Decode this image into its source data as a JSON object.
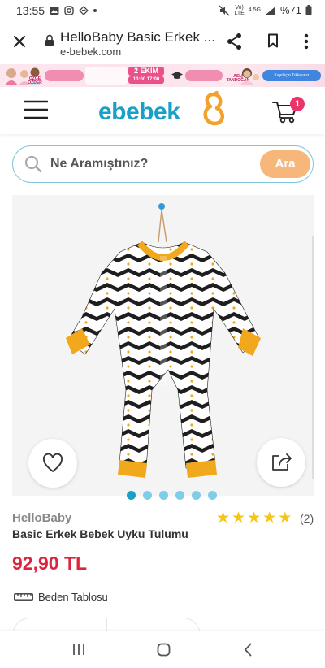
{
  "status_bar": {
    "time": "13:55",
    "net_top": "Vo)",
    "net_bottom": "LTE",
    "signal_label": "4.5G",
    "battery": "%71"
  },
  "browser": {
    "page_title": "HelloBaby Basic Erkek ...",
    "url": "e-bebek.com"
  },
  "promo": {
    "left_tag": "ÖZGE ÖZDER",
    "date_top": "2 EKİM",
    "date_time": "10:00 17:00",
    "right_tag": "ASLI TANDOĞAN",
    "cta": "Kayıt için Tıklayınız"
  },
  "header": {
    "logo": "ebebek",
    "cart_count": "1"
  },
  "search": {
    "placeholder": "Ne Aramıştınız?",
    "button_label": "Ara"
  },
  "product": {
    "brand": "HelloBaby",
    "name": "Basic Erkek Bebek Uyku Tulumu",
    "price": "92,90 TL",
    "rating_stars": 5,
    "review_count": "(2)",
    "size_table_label": "Beden Tablosu",
    "gallery_count": 6,
    "gallery_active": 0
  },
  "colors": {
    "brand_blue": "#1aa0c7",
    "price_red": "#e0233d",
    "search_button": "#f7b77a",
    "star": "#f5c518",
    "romper_trim": "#f2a81d"
  }
}
